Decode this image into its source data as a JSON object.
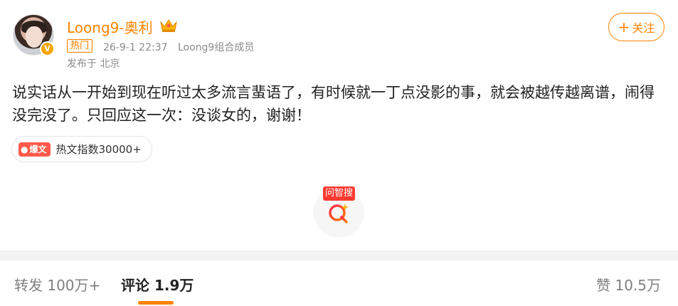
{
  "post": {
    "username": "Loong9-奥利",
    "crown_icon": "crown-icon",
    "verified_icon": "verified-v-icon",
    "hot_tag": "热门",
    "time": "26-9-1 22:37",
    "source": "Loong9组合成员",
    "location": "发布于 北京",
    "follow_label": "关注",
    "content": "说实话从一开始到现在听过太多流言蜚语了，有时候就一丁点没影的事，就会被越传越离谱，闹得没完没了。只回应这一次：没谈女的，谢谢！",
    "hotness_badge": "爆文",
    "hotness_text": "热文指数30000+"
  },
  "search_widget": {
    "label": "问智搜",
    "icon": "search-q-icon"
  },
  "tabs": {
    "repost": "转发 100万+",
    "comment": "评论 1.9万",
    "like": "赞 10.5万"
  },
  "colors": {
    "accent": "#ff8200",
    "badge_red": "#ff5a4a",
    "search_red": "#ff3b30"
  }
}
